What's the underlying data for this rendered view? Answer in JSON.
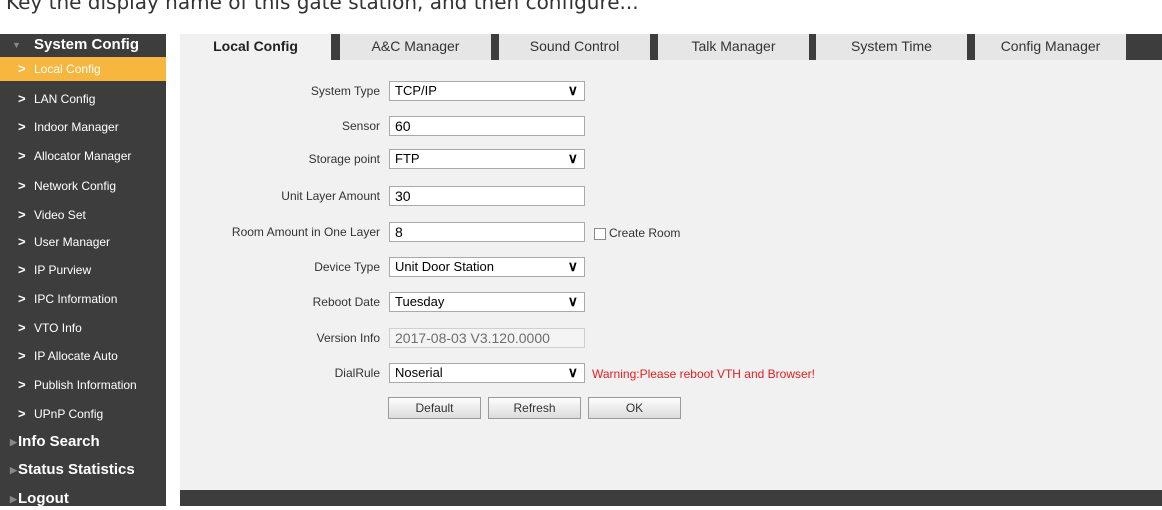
{
  "page_caption": "Key the display name of this gate station, and then configure...",
  "sidebar": {
    "section_title": "System Config",
    "items": [
      {
        "label": "Local Config",
        "active": true
      },
      {
        "label": "LAN Config"
      },
      {
        "label": "Indoor Manager"
      },
      {
        "label": "Allocator Manager"
      },
      {
        "label": "Network Config"
      },
      {
        "label": "Video Set"
      },
      {
        "label": "User Manager"
      },
      {
        "label": "IP Purview"
      },
      {
        "label": "IPC Information"
      },
      {
        "label": "VTO Info"
      },
      {
        "label": "IP Allocate Auto"
      },
      {
        "label": "Publish Information"
      },
      {
        "label": "UPnP Config"
      }
    ],
    "sections": [
      "Info Search",
      "Status Statistics",
      "Logout"
    ]
  },
  "tabs": [
    "Local Config",
    "A&C Manager",
    "Sound Control",
    "Talk Manager",
    "System Time",
    "Config Manager"
  ],
  "form": {
    "system_type": {
      "label": "System Type",
      "value": "TCP/IP"
    },
    "sensor": {
      "label": "Sensor",
      "value": "60"
    },
    "storage_point": {
      "label": "Storage point",
      "value": "FTP"
    },
    "unit_layer_amount": {
      "label": "Unit Layer Amount",
      "value": "30"
    },
    "room_amount": {
      "label": "Room Amount in One Layer",
      "value": "8",
      "checkbox_label": "Create Room"
    },
    "device_type": {
      "label": "Device Type",
      "value": "Unit Door Station"
    },
    "reboot_date": {
      "label": "Reboot Date",
      "value": "Tuesday"
    },
    "version_info": {
      "label": "Version Info",
      "value": "2017-08-03 V3.120.0000"
    },
    "dial_rule": {
      "label": "DialRule",
      "value": "Noserial",
      "warning": "Warning:Please reboot VTH and Browser!"
    }
  },
  "buttons": {
    "default": "Default",
    "refresh": "Refresh",
    "ok": "OK"
  },
  "colors": {
    "sidebar_bg": "#3d3d3d",
    "active_item": "#f7b63e",
    "warning": "#e02020"
  }
}
